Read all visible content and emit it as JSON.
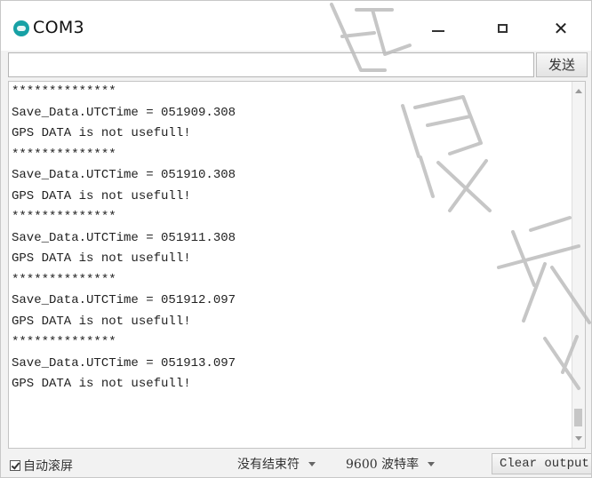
{
  "window": {
    "title": "COM3",
    "icon": "arduino-icon",
    "controls": {
      "minimize": "–",
      "maximize": "□",
      "close": "✕"
    }
  },
  "send": {
    "input_value": "",
    "button_label": "发送"
  },
  "output": {
    "lines": [
      "**************",
      "Save_Data.UTCTime = 051909.308",
      "GPS DATA is not usefull!",
      "**************",
      "Save_Data.UTCTime = 051910.308",
      "GPS DATA is not usefull!",
      "**************",
      "Save_Data.UTCTime = 051911.308",
      "GPS DATA is not usefull!",
      "**************",
      "Save_Data.UTCTime = 051912.097",
      "GPS DATA is not usefull!",
      "**************",
      "Save_Data.UTCTime = 051913.097",
      "GPS DATA is not usefull!"
    ]
  },
  "footer": {
    "autoscroll_label": "自动滚屏",
    "autoscroll_checked": true,
    "line_ending": "没有结束符",
    "baud_rate": "9600 波特率",
    "clear_label": "Clear output"
  },
  "watermark": {
    "color": "#bdbdbd"
  },
  "colors": {
    "icon_teal": "#17a1a5",
    "window_bg": "#f2f2f2"
  }
}
